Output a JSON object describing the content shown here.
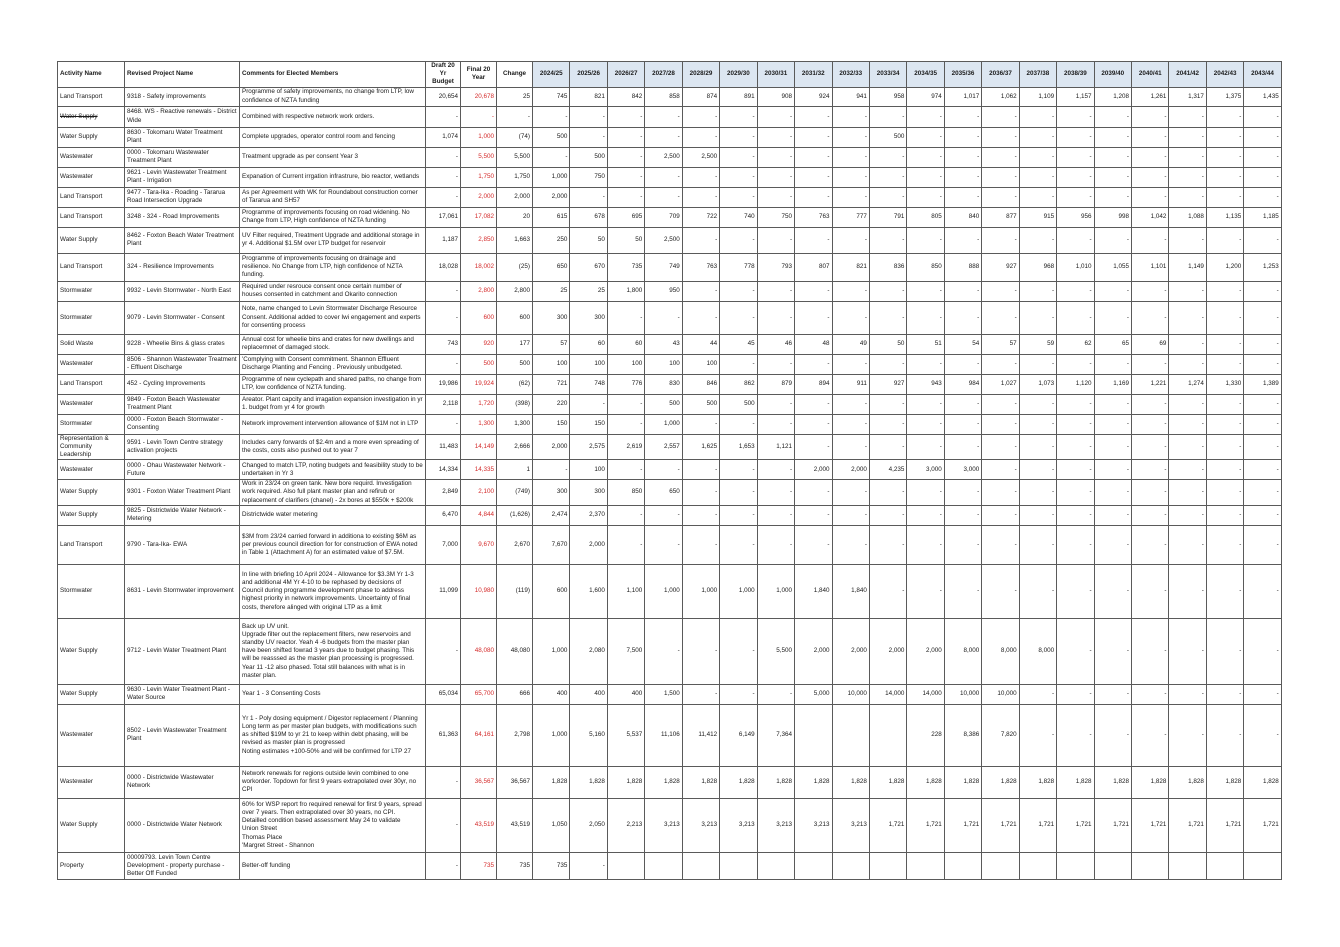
{
  "headers": {
    "activity": "Activity Name",
    "project": "Revised Project Name",
    "comments": "Comments for Elected Members",
    "draft": "Draft 20 Yr Budget",
    "final": "Final 20 Year",
    "change": "Change",
    "years": [
      "2024/25",
      "2025/26",
      "2026/27",
      "2027/28",
      "2028/29",
      "2029/30",
      "2030/31",
      "2031/32",
      "2032/33",
      "2033/34",
      "2034/35",
      "2035/36",
      "2036/37",
      "2037/38",
      "2038/39",
      "2039/40",
      "2040/41",
      "2041/42",
      "2042/43",
      "2043/44"
    ]
  },
  "rows": [
    {
      "activity": "Land Transport",
      "project": "9318 - Safety improvements",
      "comments": "Programme of safety improvements, no change from LTP, low confidence of NZTA funding",
      "draft": "20,654",
      "final": "20,678",
      "change": "25",
      "years": [
        "745",
        "821",
        "842",
        "858",
        "874",
        "891",
        "908",
        "924",
        "941",
        "958",
        "974",
        "1,017",
        "1,062",
        "1,109",
        "1,157",
        "1,208",
        "1,261",
        "1,317",
        "1,375",
        "1,435"
      ]
    },
    {
      "activity": "Water Supply",
      "activity_struck": true,
      "project": "8468. WS - Reactive renewals - District Wide",
      "comments": "Combined with respective network work orders.",
      "draft": "-",
      "final": "-",
      "change": "-",
      "years": [
        "-",
        "-",
        "-",
        "-",
        "-",
        "-",
        "-",
        "-",
        "-",
        "-",
        "-",
        "-",
        "-",
        "-",
        "-",
        "-",
        "-",
        "-",
        "-",
        "-"
      ]
    },
    {
      "activity": "Water Supply",
      "project": "8630 - Tokomaru Water Treatment Plant",
      "comments": "Complete upgrades, operator control room and fencing",
      "draft": "1,074",
      "final": "1,000",
      "change": "(74)",
      "years": [
        "500",
        "-",
        "-",
        "-",
        "-",
        "-",
        "-",
        "-",
        "-",
        "500",
        "-",
        "-",
        "-",
        "-",
        "-",
        "-",
        "-",
        "-",
        "-",
        "-"
      ]
    },
    {
      "activity": "Wastewater",
      "project": "0000 - Tokomaru Wastewater Treatment Plant",
      "comments": "Treatment upgrade as per consent Year 3",
      "draft": "-",
      "final": "5,500",
      "change": "5,500",
      "years": [
        "-",
        "500",
        "-",
        "2,500",
        "2,500",
        "-",
        "-",
        "-",
        "-",
        "-",
        "-",
        "-",
        "-",
        "-",
        "-",
        "-",
        "-",
        "-",
        "-",
        "-"
      ]
    },
    {
      "activity": "Wastewater",
      "project": "9621 - Levin Wastewater Treatment Plant - Irrigation",
      "comments": "Expanation of Current irrgation infrastrure, bio reactor, wetlands",
      "draft": "-",
      "final": "1,750",
      "change": "1,750",
      "years": [
        "1,000",
        "750",
        "-",
        "-",
        "-",
        "-",
        "-",
        "-",
        "-",
        "-",
        "-",
        "-",
        "-",
        "-",
        "-",
        "-",
        "-",
        "-",
        "-",
        "-"
      ]
    },
    {
      "activity": "Land Transport",
      "project": "9477 - Tara-Ika - Roading - Tararua Road Intersection Upgrade",
      "comments": "As per Agreement with WK for Roundabout construction corner of Tararua and SH57",
      "draft": "-",
      "final": "2,000",
      "change": "2,000",
      "years": [
        "2,000",
        "-",
        "-",
        "-",
        "-",
        "-",
        "-",
        "-",
        "-",
        "-",
        "-",
        "-",
        "-",
        "-",
        "-",
        "-",
        "-",
        "-",
        "-",
        "-"
      ]
    },
    {
      "activity": "Land Transport",
      "project": "3248 - 324 - Road Improvements",
      "comments": "Programme of improvements focusing on road widening. No Change from LTP, High confidence of NZTA funding",
      "draft": "17,061",
      "final": "17,082",
      "change": "20",
      "years": [
        "615",
        "678",
        "695",
        "709",
        "722",
        "740",
        "750",
        "763",
        "777",
        "791",
        "805",
        "840",
        "877",
        "915",
        "956",
        "998",
        "1,042",
        "1,088",
        "1,135",
        "1,185"
      ]
    },
    {
      "activity": "Water Supply",
      "project": "8462 - Foxton Beach Water Treatment Plant",
      "comments": "UV Filter required, Treatment Upgrade and additional storage in yr 4. Additional $1.5M over LTP budget for reservoir",
      "draft": "1,187",
      "final": "2,850",
      "change": "1,663",
      "years": [
        "250",
        "50",
        "50",
        "2,500",
        "-",
        "-",
        "-",
        "-",
        "-",
        "-",
        "-",
        "-",
        "-",
        "-",
        "-",
        "-",
        "-",
        "-",
        "-",
        "-"
      ]
    },
    {
      "activity": "Land Transport",
      "project": "324 - Resilience Improvements",
      "comments": "Programme of improvements focusing on drainage and resilience. No Change from LTP, high confidence of NZTA funding.",
      "draft": "18,028",
      "final": "18,002",
      "change": "(25)",
      "years": [
        "650",
        "670",
        "735",
        "749",
        "763",
        "778",
        "793",
        "807",
        "821",
        "836",
        "850",
        "888",
        "927",
        "968",
        "1,010",
        "1,055",
        "1,101",
        "1,149",
        "1,200",
        "1,253"
      ]
    },
    {
      "activity": "Stormwater",
      "project": "9932 - Levin Stormwater - North East",
      "comments": "Required under resrouce consent once certain number of houses consented in catchment and Okarito connection",
      "draft": "-",
      "final": "2,800",
      "change": "2,800",
      "years": [
        "25",
        "25",
        "1,800",
        "950",
        "-",
        "-",
        "-",
        "-",
        "-",
        "-",
        "-",
        "-",
        "-",
        "-",
        "-",
        "-",
        "-",
        "-",
        "-",
        "-"
      ]
    },
    {
      "activity": "Stormwater",
      "project": "9079 - Levin Stormwater - Consent",
      "comments": "Note, name changed to Levin Stormwater Discharge Resource Consent. Additional added to cover Iwi engagement and experts for consenting process",
      "draft": "-",
      "final": "600",
      "change": "600",
      "years": [
        "300",
        "300",
        "-",
        "-",
        "-",
        "-",
        "-",
        "-",
        "-",
        "-",
        "-",
        "-",
        "-",
        "-",
        "-",
        "-",
        "-",
        "-",
        "-",
        "-"
      ]
    },
    {
      "activity": "Solid Waste",
      "project": "9228 - Wheelie Bins & glass crates",
      "comments": "Annual cost for wheelie bins and crates for new dwellings and replacemnet of damaged stock.",
      "draft": "743",
      "final": "920",
      "change": "177",
      "years": [
        "57",
        "60",
        "60",
        "43",
        "44",
        "45",
        "46",
        "48",
        "49",
        "50",
        "51",
        "54",
        "57",
        "59",
        "62",
        "65",
        "69",
        "-",
        "-",
        "-"
      ]
    },
    {
      "activity": "Wastewater",
      "project": "8506 - Shannon Wastewater Treatment - Effluent Discharge",
      "comments": "'Complying with Consent commitment. Shannon Effluent Discharge Planting and Fencing . Previously unbudgeted.",
      "draft": "-",
      "final": "500",
      "change": "500",
      "years": [
        "100",
        "100",
        "100",
        "100",
        "100",
        "-",
        "-",
        "-",
        "-",
        "-",
        "-",
        "-",
        "-",
        "-",
        "-",
        "-",
        "-",
        "-",
        "-",
        "-"
      ]
    },
    {
      "activity": "Land Transport",
      "project": "452 - Cycling Improvements",
      "comments": "Programme of new cyclepath and shared paths, no change from LTP, low confidence of NZTA funding.",
      "draft": "19,986",
      "final": "19,924",
      "change": "(62)",
      "years": [
        "721",
        "748",
        "776",
        "830",
        "846",
        "862",
        "879",
        "894",
        "911",
        "927",
        "943",
        "984",
        "1,027",
        "1,073",
        "1,120",
        "1,169",
        "1,221",
        "1,274",
        "1,330",
        "1,389"
      ]
    },
    {
      "activity": "Wastewater",
      "project": "9849 - Foxton Beach Wastewater Treatment Plant",
      "comments": "Areator. Plant capcity and irragation expansion investigation in yr 1. budget from yr 4 for growth",
      "draft": "2,118",
      "final": "1,720",
      "change": "(398)",
      "years": [
        "220",
        "-",
        "-",
        "500",
        "500",
        "500",
        "-",
        "-",
        "-",
        "-",
        "-",
        "-",
        "-",
        "-",
        "-",
        "-",
        "-",
        "-",
        "-",
        "-"
      ]
    },
    {
      "activity": "Stormwater",
      "project": "0000 - Foxton Beach Stormwater - Consenting",
      "comments": "Network improvement intervention allowance of $1M not in LTP",
      "draft": "-",
      "final": "1,300",
      "change": "1,300",
      "years": [
        "150",
        "150",
        "-",
        "1,000",
        "-",
        "-",
        "-",
        "-",
        "-",
        "-",
        "-",
        "-",
        "-",
        "-",
        "-",
        "-",
        "-",
        "-",
        "-",
        "-"
      ]
    },
    {
      "activity": "Representation & Community Leadership",
      "project": "9591 - Levin Town Centre strategy activation projects",
      "comments": "Includes carry forwards of $2.4m and a more even spreading of the costs, costs also pushed out to year 7",
      "draft": "11,483",
      "final": "14,149",
      "change": "2,666",
      "years": [
        "2,000",
        "2,575",
        "2,619",
        "2,557",
        "1,625",
        "1,653",
        "1,121",
        "-",
        "-",
        "-",
        "-",
        "-",
        "-",
        "-",
        "-",
        "-",
        "-",
        "-",
        "-",
        "-"
      ]
    },
    {
      "activity": "Wastewater",
      "project": "0000 - Ohau Wastewater Network - Future",
      "comments": "Changed to match LTP, noting budgets and feasibility study to be undertaken in Yr 3",
      "draft": "14,334",
      "final": "14,335",
      "change": "1",
      "years": [
        "-",
        "100",
        "-",
        "-",
        "-",
        "-",
        "-",
        "2,000",
        "2,000",
        "4,235",
        "3,000",
        "3,000",
        "-",
        "-",
        "-",
        "-",
        "-",
        "-",
        "-",
        "-"
      ]
    },
    {
      "activity": "Water Supply",
      "project": "9301 - Foxton Water Treatment Plant",
      "comments": "Work in 23/24 on green tank. New bore requird. Investigation work required. Also full plant master plan and refirub or replacement of clarifiers (chanel) - 2x bores at $550k + $200k",
      "draft": "2,849",
      "final": "2,100",
      "change": "(749)",
      "years": [
        "300",
        "300",
        "850",
        "650",
        "-",
        "-",
        "-",
        "-",
        "-",
        "-",
        "-",
        "-",
        "-",
        "-",
        "-",
        "-",
        "-",
        "-",
        "-",
        "-"
      ]
    },
    {
      "activity": "Water Supply",
      "project": "9825 - Districtwide Water Network - Metering",
      "comments": "Districtwide water metering",
      "draft": "6,470",
      "final": "4,844",
      "change": "(1,626)",
      "years": [
        "2,474",
        "2,370",
        "-",
        "-",
        "-",
        "-",
        "-",
        "-",
        "-",
        "-",
        "-",
        "-",
        "-",
        "-",
        "-",
        "-",
        "-",
        "-",
        "-",
        "-"
      ]
    },
    {
      "activity": "Land Transport",
      "project": "9790 - Tara-Ika- EWA",
      "comments": "$3M from 23/24 carried forward in additiona to existing $6M as per previous council direction for for construction of EWA noted in Table 1 (Attachment A) for an estimated value of $7.5M.",
      "draft": "7,000",
      "final": "9,670",
      "change": "2,670",
      "years": [
        "7,670",
        "2,000",
        "-",
        "-",
        "-",
        "-",
        "-",
        "-",
        "-",
        "-",
        "-",
        "-",
        "-",
        "-",
        "-",
        "-",
        "-",
        "-",
        "-",
        "-"
      ]
    },
    {
      "activity": "Stormwater",
      "project": "8631 - Levin Stormwater improvement",
      "comments": "In line with briefing 10 April 2024 - Allowance for $3.3M Yr 1-3 and additional 4M Yr 4-10 to be rephased by decisions of Council during programme development phase to address highest priority in network improvements. Uncertainty of final costs, therefore alinged with original LTP as a limit",
      "draft": "11,099",
      "final": "10,980",
      "change": "(119)",
      "years": [
        "600",
        "1,600",
        "1,100",
        "1,000",
        "1,000",
        "1,000",
        "1,000",
        "1,840",
        "1,840",
        "-",
        "-",
        "-",
        "-",
        "-",
        "-",
        "-",
        "-",
        "-",
        "-",
        "-"
      ]
    },
    {
      "activity": "Water Supply",
      "project": "9712 - Levin Water Treatment Plant",
      "comments": "Back up UV unit.\nUpgrade filter out the replacement filters, new reservoirs and standby UV reactor. Yeah 4 -6 budgets from the master plan have been shifted fowrad 3 years due to budget phasing. This will be reasssed as the master plan processing is progressed. Year 11 -12 also phased. Total still balances with what is in master plan.",
      "draft": "-",
      "final": "48,080",
      "change": "48,080",
      "years": [
        "1,000",
        "2,080",
        "7,500",
        "-",
        "-",
        "-",
        "5,500",
        "2,000",
        "2,000",
        "2,000",
        "2,000",
        "8,000",
        "8,000",
        "8,000",
        "-",
        "-",
        "-",
        "-",
        "-",
        "-"
      ]
    },
    {
      "activity": "Water Supply",
      "project": "9630 - Levin Water Treatment Plant - Water Source",
      "comments": "Year 1 - 3 Consenting Costs",
      "draft": "65,034",
      "final": "65,700",
      "change": "666",
      "years": [
        "400",
        "400",
        "400",
        "1,500",
        "-",
        "-",
        "-",
        "5,000",
        "10,000",
        "14,000",
        "14,000",
        "10,000",
        "10,000",
        "-",
        "-",
        "-",
        "-",
        "-",
        "-",
        "-"
      ]
    },
    {
      "activity": "Wastewater",
      "project": "8502 - Levin Wastewater Treatment Plant",
      "comments": "Yr 1 - Poly dosing equipment / Digestor replacement / Planning\nLong term as per master plan budgets, with modifications such as shifted $19M to yr 21 to keep within debt phasing, will be revised as master plan is progressed\nNoting estimates +100-50% and will be confirmed for LTP 27",
      "draft": "61,363",
      "final": "64,161",
      "change": "2,798",
      "years": [
        "1,000",
        "5,160",
        "5,537",
        "11,106",
        "11,412",
        "6,149",
        "7,364",
        "",
        "",
        "",
        "228",
        "8,386",
        "7,820",
        "-",
        "-",
        "-",
        "-",
        "-",
        "-",
        "-"
      ]
    },
    {
      "activity": "Wastewater",
      "project": "0000 - Districtwide Wastewater Network",
      "comments": "Network renewals for regions outside levin combined to one workorder. Topdown for first 9 years extrapolated over 30yr, no CPI",
      "draft": "-",
      "final": "36,567",
      "change": "36,567",
      "years": [
        "1,828",
        "1,828",
        "1,828",
        "1,828",
        "1,828",
        "1,828",
        "1,828",
        "1,828",
        "1,828",
        "1,828",
        "1,828",
        "1,828",
        "1,828",
        "1,828",
        "1,828",
        "1,828",
        "1,828",
        "1,828",
        "1,828",
        "1,828"
      ]
    },
    {
      "activity": "Water Supply",
      "project": "0000 - Districtwide Water Network",
      "comments": "60% for WSP report fro required renewal for first 9 years, spread over 7 years. Then extrapolated over 30 years, no CPI.\nDetailled condition based assessment May 24 to validate\nUnion Street\nThomas Place\n'Margret Street - Shannon",
      "draft": "-",
      "final": "43,519",
      "change": "43,519",
      "years": [
        "1,050",
        "2,050",
        "2,213",
        "3,213",
        "3,213",
        "3,213",
        "3,213",
        "3,213",
        "3,213",
        "1,721",
        "1,721",
        "1,721",
        "1,721",
        "1,721",
        "1,721",
        "1,721",
        "1,721",
        "1,721",
        "1,721",
        "1,721"
      ]
    },
    {
      "activity": "Property",
      "project": "00009793. Levin Town Centre Development - property purchase - Better Off Funded",
      "comments": "Better-off funding",
      "draft": "-",
      "final": "735",
      "change": "735",
      "years": [
        "735",
        "-",
        "",
        "",
        "",
        "",
        "",
        "",
        "",
        "",
        "",
        "",
        "",
        "",
        "",
        "",
        "",
        "",
        "",
        ""
      ]
    }
  ]
}
